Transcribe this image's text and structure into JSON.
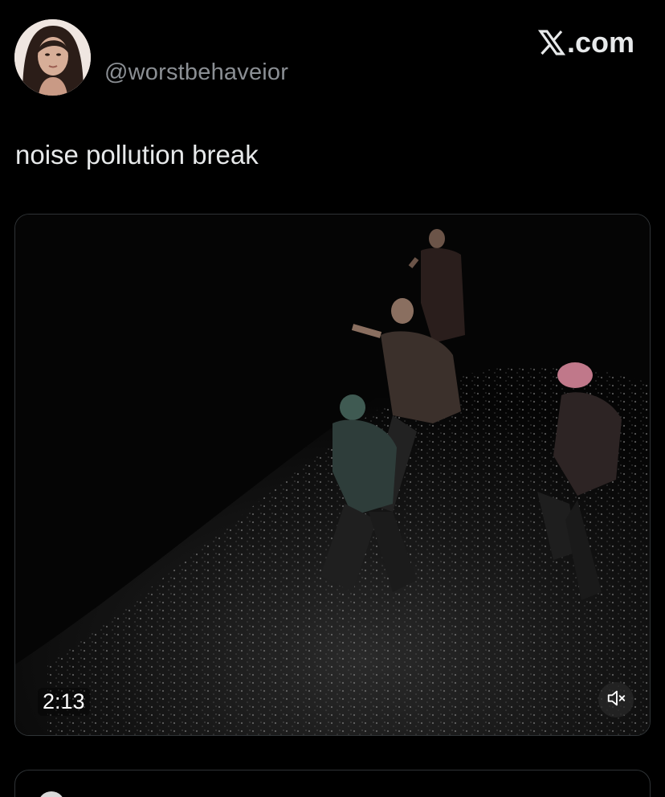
{
  "post": {
    "handle": "@worstbehaveior",
    "text": "noise pollution break",
    "avatar_icon": "profile-photo"
  },
  "brand": {
    "label": ".com",
    "icon": "x-logo-icon"
  },
  "video": {
    "duration": "2:13",
    "mute_icon": "speaker-muted-icon"
  },
  "colors": {
    "background": "#000000",
    "text": "#e7e9ea",
    "muted_text": "#8b8f94",
    "border": "#2f3336"
  }
}
